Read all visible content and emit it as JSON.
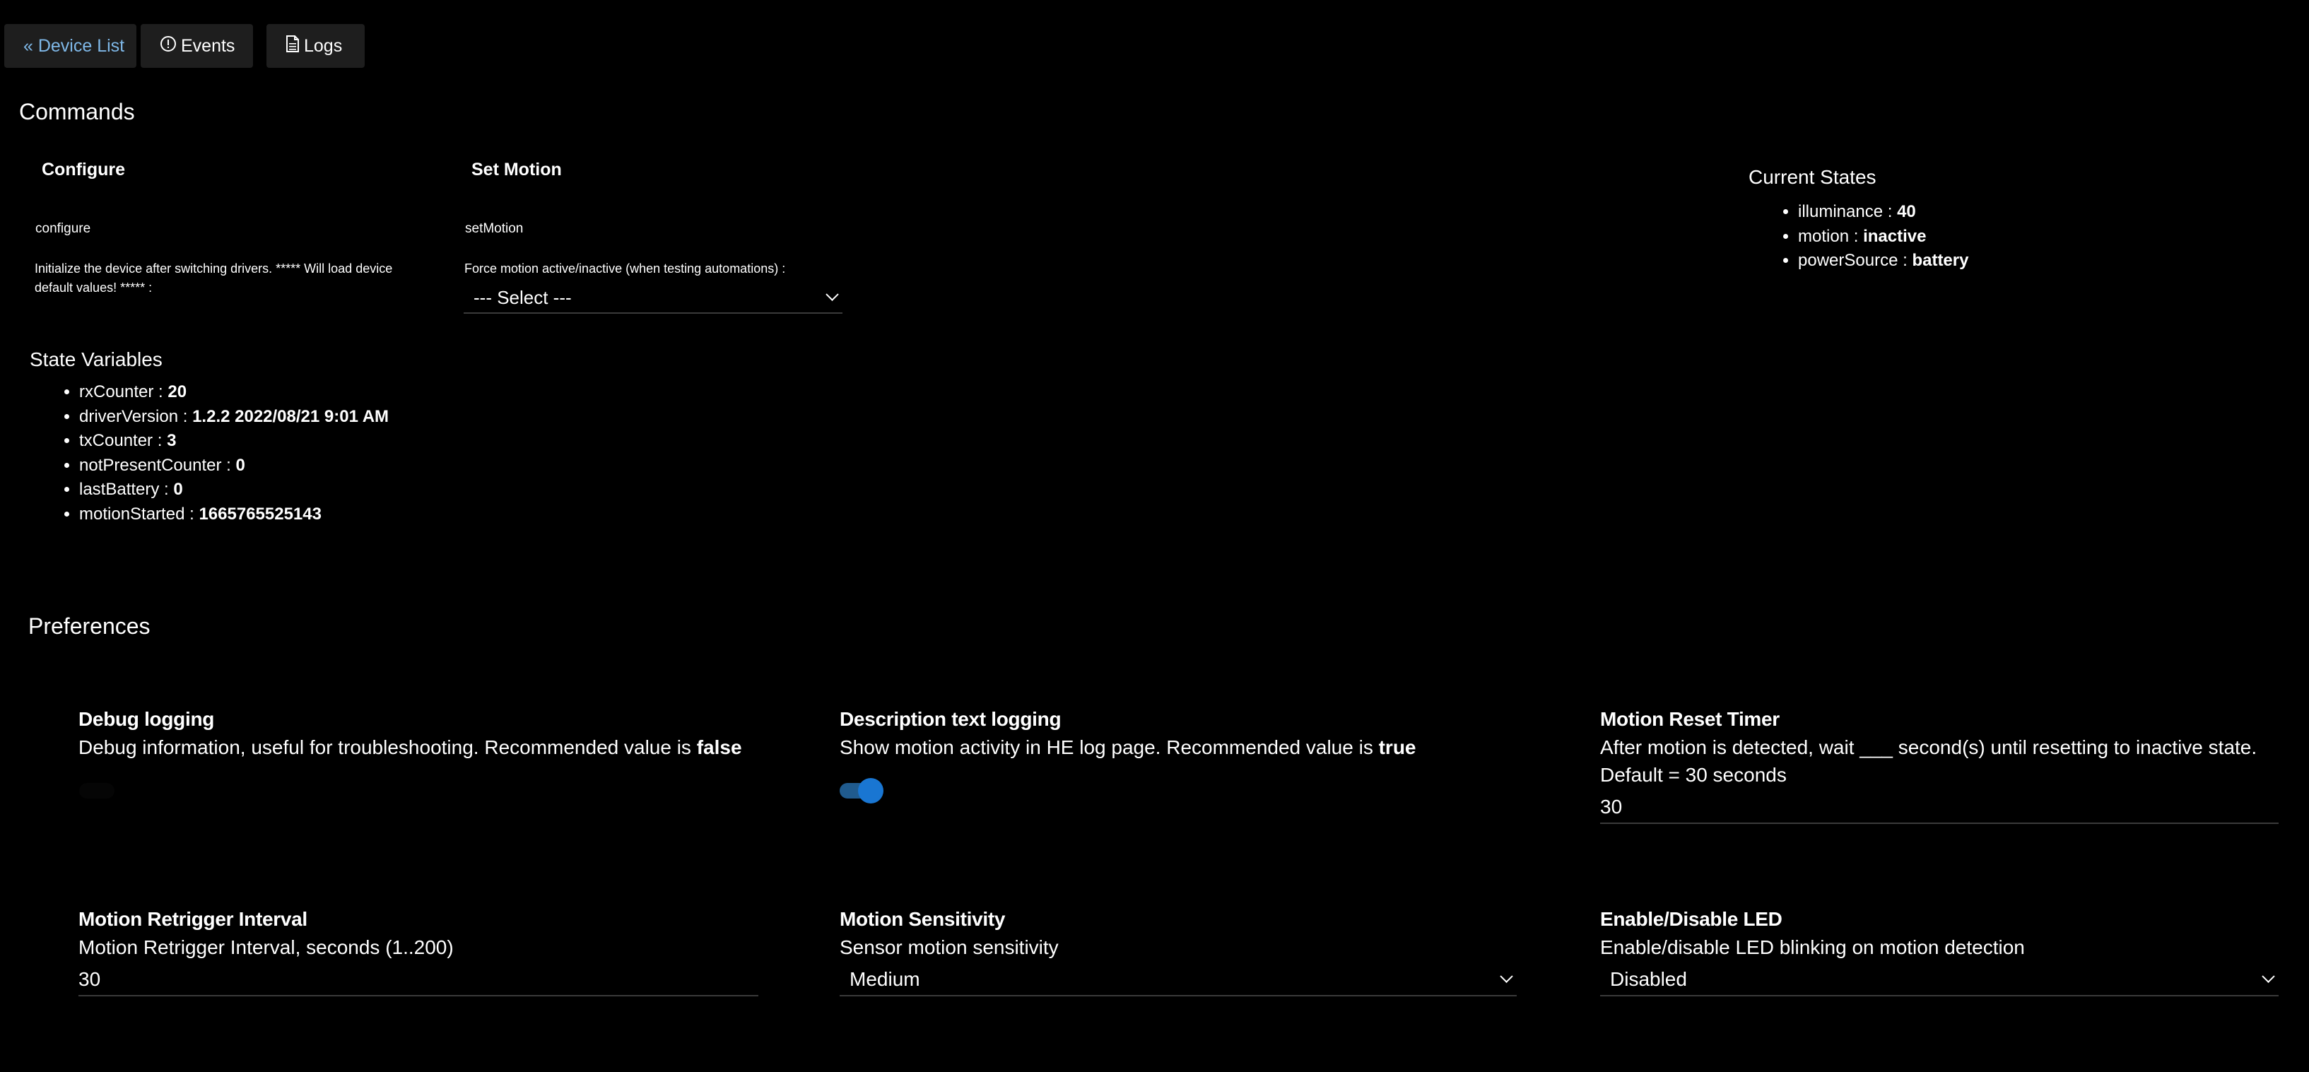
{
  "nav": {
    "device_list_label": "« Device List",
    "events_label": "Events",
    "logs_label": "Logs"
  },
  "commands": {
    "heading": "Commands",
    "items": [
      {
        "title": "Configure",
        "name": "configure",
        "description": "Initialize the device after switching drivers. ***** Will load device default values! ***** :"
      },
      {
        "title": "Set Motion",
        "name": "setMotion",
        "description": "Force motion active/inactive (when testing automations) :",
        "select_value": "--- Select ---"
      }
    ]
  },
  "current_states": {
    "heading": "Current States",
    "items": [
      {
        "key": "illuminance",
        "value": "40"
      },
      {
        "key": "motion",
        "value": "inactive"
      },
      {
        "key": "powerSource",
        "value": "battery"
      }
    ]
  },
  "state_variables": {
    "heading": "State Variables",
    "items": [
      {
        "key": "rxCounter",
        "value": "20"
      },
      {
        "key": "driverVersion",
        "value": "1.2.2 2022/08/21 9:01 AM"
      },
      {
        "key": "txCounter",
        "value": "3"
      },
      {
        "key": "notPresentCounter",
        "value": "0"
      },
      {
        "key": "lastBattery",
        "value": "0"
      },
      {
        "key": "motionStarted",
        "value": "1665765525143"
      }
    ]
  },
  "preferences": {
    "heading": "Preferences",
    "debug_logging": {
      "title": "Debug logging",
      "description": "Debug information, useful for troubleshooting. Recommended value is",
      "recommended": "false",
      "enabled": false
    },
    "description_text_logging": {
      "title": "Description text logging",
      "description": "Show motion activity in HE log page. Recommended value is",
      "recommended": "true",
      "enabled": true
    },
    "motion_reset_timer": {
      "title": "Motion Reset Timer",
      "description_line1": "After motion is detected, wait ___ second(s) until resetting to inactive state.",
      "description_line2": "Default = 30 seconds",
      "value": "30"
    },
    "motion_retrigger_interval": {
      "title": "Motion Retrigger Interval",
      "description": "Motion Retrigger Interval, seconds (1..200)",
      "value": "30"
    },
    "motion_sensitivity": {
      "title": "Motion Sensitivity",
      "description": "Sensor motion sensitivity",
      "value": "Medium"
    },
    "enable_disable_led": {
      "title": "Enable/Disable LED",
      "description": "Enable/disable LED blinking on motion detection",
      "value": "Disabled"
    }
  },
  "colors": {
    "background": "#000000",
    "link": "#7fb8e8",
    "button_bg": "#1e1e1e",
    "toggle_on": "#1976d2"
  }
}
